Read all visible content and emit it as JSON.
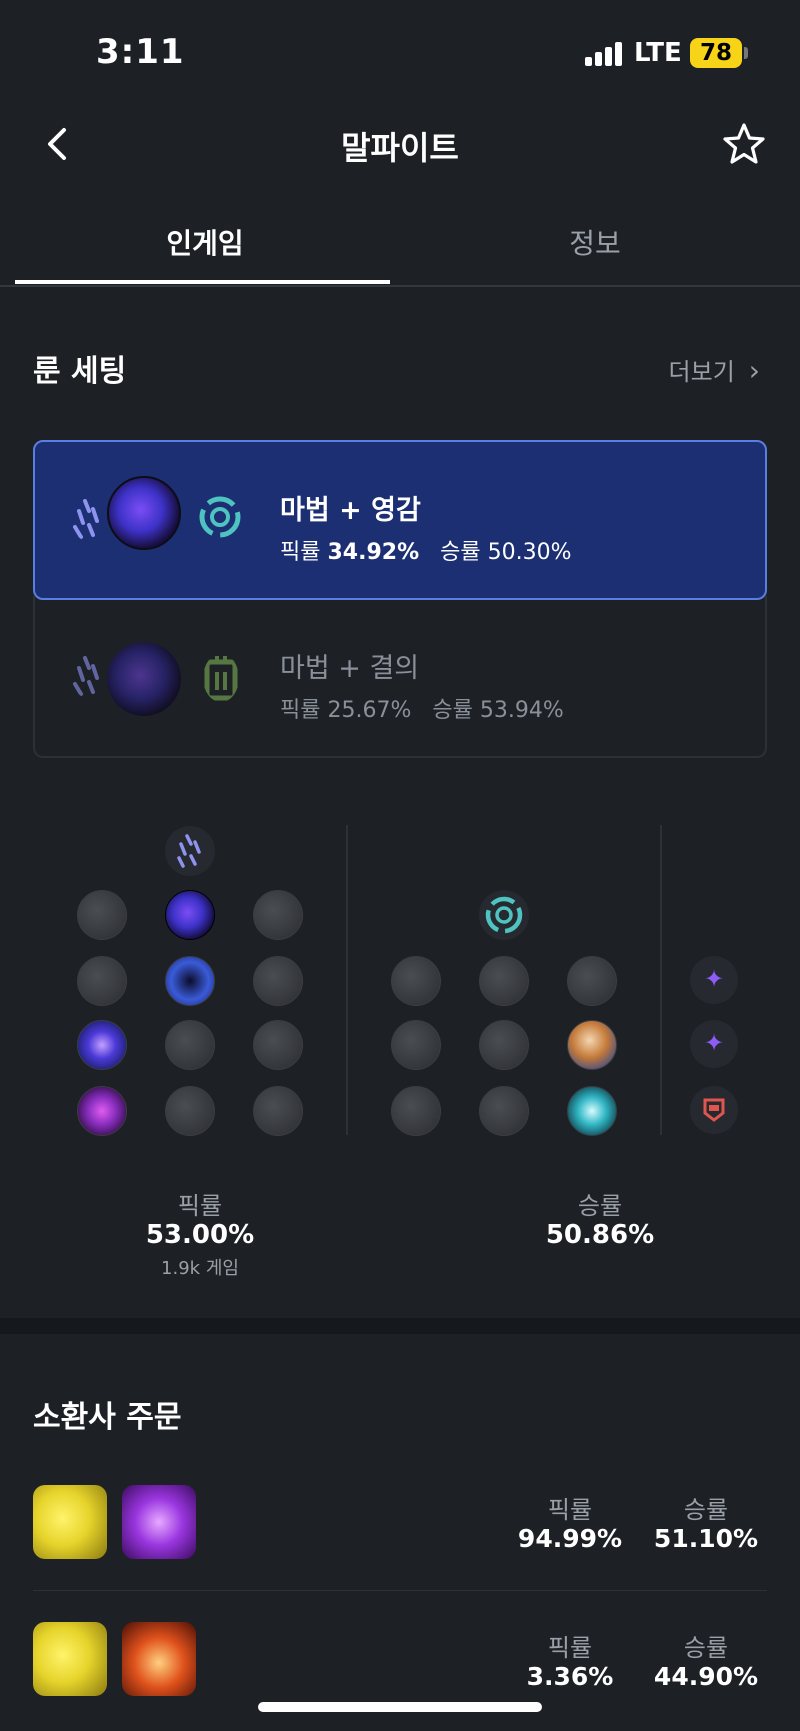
{
  "status_bar": {
    "time": "3:11",
    "network": "LTE",
    "battery": "78"
  },
  "header": {
    "title": "말파이트"
  },
  "tabs": [
    {
      "label": "인게임"
    },
    {
      "label": "정보"
    }
  ],
  "rune_section": {
    "title": "룬 세팅",
    "more_label": "더보기",
    "options": [
      {
        "title": "마법 + 영감",
        "pick_label": "픽률",
        "pick": "34.92%",
        "win_label": "승률",
        "win": "50.30%"
      },
      {
        "title": "마법 + 결의",
        "pick_label": "픽률",
        "pick": "25.67%",
        "win_label": "승률",
        "win": "53.94%"
      }
    ],
    "summary": {
      "pick_label": "픽률",
      "pick": "53.00%",
      "games": "1.9k 게임",
      "win_label": "승률",
      "win": "50.86%"
    }
  },
  "spells_section": {
    "title": "소환사 주문",
    "rows": [
      {
        "pick_label": "픽률",
        "pick": "94.99%",
        "win_label": "승률",
        "win": "51.10%"
      },
      {
        "pick_label": "픽률",
        "pick": "3.36%",
        "win_label": "승률",
        "win": "44.90%"
      }
    ]
  },
  "colors": {
    "accent": "#5b7ee0",
    "active_card": "#1c2f73",
    "background": "#1d2126"
  }
}
